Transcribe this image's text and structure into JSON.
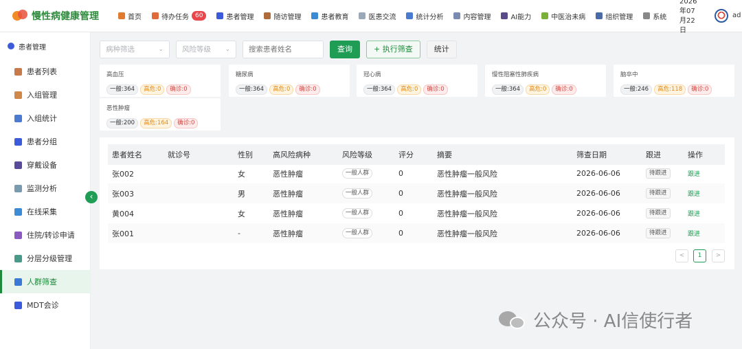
{
  "app": {
    "title": "慢性病健康管理"
  },
  "nav": [
    {
      "label": "首页",
      "color": "#e07a2e",
      "icon": "home-icon"
    },
    {
      "label": "待办任务",
      "color": "#e06a3a",
      "icon": "task-icon",
      "badge": "60"
    },
    {
      "label": "患者管理",
      "color": "#3b5bdb",
      "icon": "user-icon"
    },
    {
      "label": "随访管理",
      "color": "#b06b3a",
      "icon": "followup-icon"
    },
    {
      "label": "患者教育",
      "color": "#3a8ad6",
      "icon": "book-icon"
    },
    {
      "label": "医患交流",
      "color": "#9aa8b8",
      "icon": "chat-icon"
    },
    {
      "label": "统计分析",
      "color": "#4a7bd1",
      "icon": "chart-icon"
    },
    {
      "label": "内容管理",
      "color": "#7a8ab0",
      "icon": "content-icon"
    },
    {
      "label": "AI能力",
      "color": "#5a4a8a",
      "icon": "ai-icon"
    },
    {
      "label": "中医治未病",
      "color": "#7ab03a",
      "icon": "herb-icon"
    },
    {
      "label": "组织管理",
      "color": "#4a6aa8",
      "icon": "org-icon"
    },
    {
      "label": "系统",
      "color": "#888888",
      "icon": "gear-icon"
    }
  ],
  "date_lines": [
    "2026",
    "年07",
    "月22",
    "日"
  ],
  "user": {
    "name": "ad"
  },
  "sidebar": {
    "group": "患者管理",
    "items": [
      {
        "label": "患者列表",
        "color": "#c77b4a",
        "icon": "clipboard-icon"
      },
      {
        "label": "入组管理",
        "color": "#d0874a",
        "icon": "edit-icon"
      },
      {
        "label": "入组统计",
        "color": "#4a7bd1",
        "icon": "bar-chart-icon"
      },
      {
        "label": "患者分组",
        "color": "#3b5bdb",
        "icon": "group-icon"
      },
      {
        "label": "穿戴设备",
        "color": "#5a4a9a",
        "icon": "watch-icon"
      },
      {
        "label": "监测分析",
        "color": "#7a9ab0",
        "icon": "trend-icon"
      },
      {
        "label": "在线采集",
        "color": "#3a8ad6",
        "icon": "sync-icon"
      },
      {
        "label": "住院/转诊申请",
        "color": "#8a5ac0",
        "icon": "form-icon"
      },
      {
        "label": "分层分级管理",
        "color": "#4a9a8a",
        "icon": "layers-icon"
      },
      {
        "label": "人群筛查",
        "color": "#3a7ad6",
        "icon": "search-icon",
        "active": true
      },
      {
        "label": "MDT会诊",
        "color": "#3b5bdb",
        "icon": "team-icon"
      }
    ]
  },
  "filters": {
    "disease_placeholder": "病种筛选",
    "risk_placeholder": "风险等级",
    "search_placeholder": "搜索患者姓名",
    "query_label": "查询",
    "run_label": "执行筛查",
    "stats_label": "统计"
  },
  "cards": [
    {
      "title": "高血压",
      "normal": "一般:364",
      "high": "高危:0",
      "diag": "确诊:0"
    },
    {
      "title": "糖尿病",
      "normal": "一般:364",
      "high": "高危:0",
      "diag": "确诊:0"
    },
    {
      "title": "冠心病",
      "normal": "一般:364",
      "high": "高危:0",
      "diag": "确诊:0"
    },
    {
      "title": "慢性阻塞性肺疾病",
      "normal": "一般:364",
      "high": "高危:0",
      "diag": "确诊:0"
    },
    {
      "title": "脑卒中",
      "normal": "一般:246",
      "high": "高危:118",
      "diag": "确诊:0"
    },
    {
      "title": "恶性肿瘤",
      "normal": "一般:200",
      "high": "高危:164",
      "diag": "确诊:0"
    }
  ],
  "table": {
    "columns": [
      "患者姓名",
      "就诊号",
      "性别",
      "高风险病种",
      "风险等级",
      "评分",
      "摘要",
      "筛查日期",
      "跟进",
      "操作"
    ],
    "rows": [
      {
        "name": "张002",
        "visit": "",
        "gender": "女",
        "disease": "恶性肿瘤",
        "risk": "一般人群",
        "score": "0",
        "summary": "恶性肿瘤一般风险",
        "date": "2026-06-06",
        "follow": "待跟进",
        "action": "跟进"
      },
      {
        "name": "张003",
        "visit": "",
        "gender": "男",
        "disease": "恶性肿瘤",
        "risk": "一般人群",
        "score": "0",
        "summary": "恶性肿瘤一般风险",
        "date": "2026-06-06",
        "follow": "待跟进",
        "action": "跟进"
      },
      {
        "name": "黄004",
        "visit": "",
        "gender": "女",
        "disease": "恶性肿瘤",
        "risk": "一般人群",
        "score": "0",
        "summary": "恶性肿瘤一般风险",
        "date": "2026-06-06",
        "follow": "待跟进",
        "action": "跟进"
      },
      {
        "name": "张001",
        "visit": "",
        "gender": "-",
        "disease": "恶性肿瘤",
        "risk": "一般人群",
        "score": "0",
        "summary": "恶性肿瘤一般风险",
        "date": "2026-06-06",
        "follow": "待跟进",
        "action": "跟进"
      }
    ]
  },
  "pagination": {
    "prev": "<",
    "current": "1",
    "next": ">"
  },
  "watermark": {
    "text": "公众号 · AI信使行者"
  }
}
